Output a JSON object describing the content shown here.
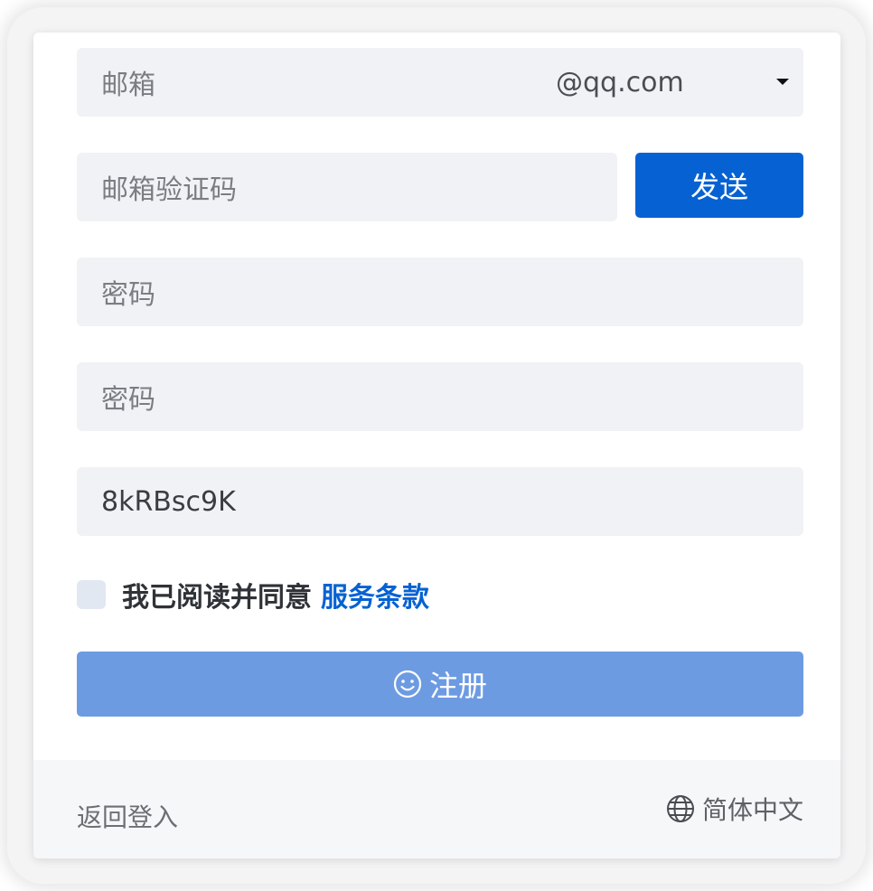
{
  "form": {
    "email_placeholder": "邮箱",
    "email_domain": "@qq.com",
    "code_placeholder": "邮箱验证码",
    "send_label": "发送",
    "password_placeholder": "密码",
    "confirm_password_placeholder": "密码",
    "captcha_value": "8kRBsc9K",
    "agree_text": "我已阅读并同意",
    "terms_link": "服务条款",
    "register_label": "注册"
  },
  "footer": {
    "back_label": "返回登入",
    "language_label": "简体中文"
  },
  "colors": {
    "primary": "#0662d2",
    "register_disabled": "#6d9be2",
    "field_bg": "#f1f2f5"
  },
  "icons": {
    "register": "smile-icon",
    "language": "globe-icon",
    "domain_select": "caret-down-icon"
  }
}
